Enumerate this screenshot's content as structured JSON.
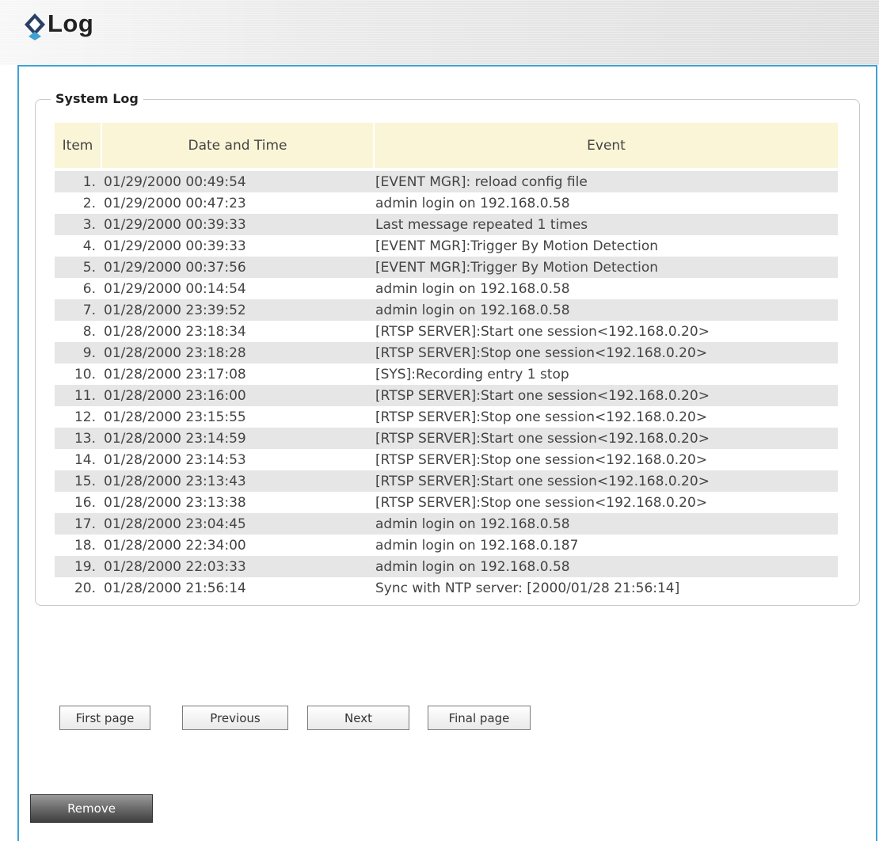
{
  "header": {
    "title": "Log",
    "logo_icon": "diamond-logo-icon"
  },
  "panel": {
    "legend": "System Log"
  },
  "table": {
    "columns": [
      "Item",
      "Date and Time",
      "Event"
    ],
    "rows": [
      {
        "item": "1.",
        "datetime": "01/29/2000 00:49:54",
        "event": "[EVENT MGR]: reload config file"
      },
      {
        "item": "2.",
        "datetime": "01/29/2000 00:47:23",
        "event": "admin login on 192.168.0.58"
      },
      {
        "item": "3.",
        "datetime": "01/29/2000 00:39:33",
        "event": "Last message repeated 1 times"
      },
      {
        "item": "4.",
        "datetime": "01/29/2000 00:39:33",
        "event": "[EVENT MGR]:Trigger By Motion Detection"
      },
      {
        "item": "5.",
        "datetime": "01/29/2000 00:37:56",
        "event": "[EVENT MGR]:Trigger By Motion Detection"
      },
      {
        "item": "6.",
        "datetime": "01/29/2000 00:14:54",
        "event": "admin login on 192.168.0.58"
      },
      {
        "item": "7.",
        "datetime": "01/28/2000 23:39:52",
        "event": "admin login on 192.168.0.58"
      },
      {
        "item": "8.",
        "datetime": "01/28/2000 23:18:34",
        "event": "[RTSP SERVER]:Start one session<192.168.0.20>"
      },
      {
        "item": "9.",
        "datetime": "01/28/2000 23:18:28",
        "event": "[RTSP SERVER]:Stop one session<192.168.0.20>"
      },
      {
        "item": "10.",
        "datetime": "01/28/2000 23:17:08",
        "event": "[SYS]:Recording entry 1 stop"
      },
      {
        "item": "11.",
        "datetime": "01/28/2000 23:16:00",
        "event": "[RTSP SERVER]:Start one session<192.168.0.20>"
      },
      {
        "item": "12.",
        "datetime": "01/28/2000 23:15:55",
        "event": "[RTSP SERVER]:Stop one session<192.168.0.20>"
      },
      {
        "item": "13.",
        "datetime": "01/28/2000 23:14:59",
        "event": "[RTSP SERVER]:Start one session<192.168.0.20>"
      },
      {
        "item": "14.",
        "datetime": "01/28/2000 23:14:53",
        "event": "[RTSP SERVER]:Stop one session<192.168.0.20>"
      },
      {
        "item": "15.",
        "datetime": "01/28/2000 23:13:43",
        "event": "[RTSP SERVER]:Start one session<192.168.0.20>"
      },
      {
        "item": "16.",
        "datetime": "01/28/2000 23:13:38",
        "event": "[RTSP SERVER]:Stop one session<192.168.0.20>"
      },
      {
        "item": "17.",
        "datetime": "01/28/2000 23:04:45",
        "event": "admin login on 192.168.0.58"
      },
      {
        "item": "18.",
        "datetime": "01/28/2000 22:34:00",
        "event": "admin login on 192.168.0.187"
      },
      {
        "item": "19.",
        "datetime": "01/28/2000 22:03:33",
        "event": "admin login on 192.168.0.58"
      },
      {
        "item": "20.",
        "datetime": "01/28/2000 21:56:14",
        "event": "Sync with NTP server: [2000/01/28 21:56:14]"
      }
    ]
  },
  "pagination": {
    "first": "First page",
    "previous": "Previous",
    "next": "Next",
    "final": "Final page"
  },
  "actions": {
    "remove": "Remove"
  },
  "colors": {
    "accent_border": "#3ea2d3",
    "header_row_bg": "#faf5d6",
    "alt_row_bg": "#e6e6e6",
    "remove_button_bg": "#5a5a5a"
  }
}
